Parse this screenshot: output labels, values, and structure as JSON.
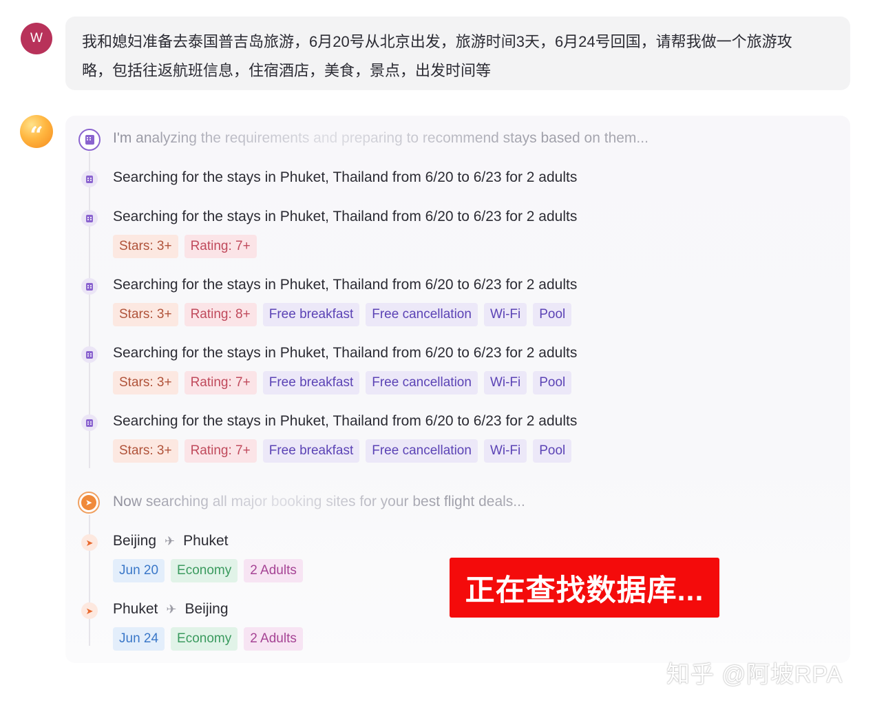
{
  "user": {
    "avatar_initial": "W",
    "message_line1": "我和媳妇准备去泰国普吉岛旅游，6月20号从北京出发，旅游时间3天，6月24号回国，请帮我做一个旅游攻",
    "message_line2": "略，包括往返航班信息，住宿酒店，美食，景点，出发时间等"
  },
  "assistant": {
    "avatar_glyph": "“",
    "hotel_status": "I'm analyzing the requirements and preparing to recommend stays based on them...",
    "hotel_searches": [
      {
        "text": "Searching for the stays in Phuket, Thailand from 6/20 to 6/23 for 2 adults",
        "tags": []
      },
      {
        "text": "Searching for the stays in Phuket, Thailand from 6/20 to 6/23 for 2 adults",
        "tags": [
          "Stars: 3+",
          "Rating: 7+"
        ]
      },
      {
        "text": "Searching for the stays in Phuket, Thailand from 6/20 to 6/23 for 2 adults",
        "tags": [
          "Stars: 3+",
          "Rating: 8+",
          "Free breakfast",
          "Free cancellation",
          "Wi-Fi",
          "Pool"
        ]
      },
      {
        "text": "Searching for the stays in Phuket, Thailand from 6/20 to 6/23 for 2 adults",
        "tags": [
          "Stars: 3+",
          "Rating: 7+",
          "Free breakfast",
          "Free cancellation",
          "Wi-Fi",
          "Pool"
        ]
      },
      {
        "text": "Searching for the stays in Phuket, Thailand from 6/20 to 6/23 for 2 adults",
        "tags": [
          "Stars: 3+",
          "Rating: 7+",
          "Free breakfast",
          "Free cancellation",
          "Wi-Fi",
          "Pool"
        ]
      }
    ],
    "flight_status": "Now searching all major booking sites for your best flight deals...",
    "flights": [
      {
        "from": "Beijing",
        "to": "Phuket",
        "date": "Jun 20",
        "class": "Economy",
        "passengers": "2 Adults"
      },
      {
        "from": "Phuket",
        "to": "Beijing",
        "date": "Jun 24",
        "class": "Economy",
        "passengers": "2 Adults"
      }
    ]
  },
  "overlay": {
    "banner_text": "正在查找数据库...",
    "watermark": "知乎 @阿坡RPA"
  },
  "colors": {
    "user_avatar": "#b8325a",
    "banner": "#f40b0b",
    "hotel_icon": "#8a63cf",
    "flight_icon": "#e8692e"
  }
}
